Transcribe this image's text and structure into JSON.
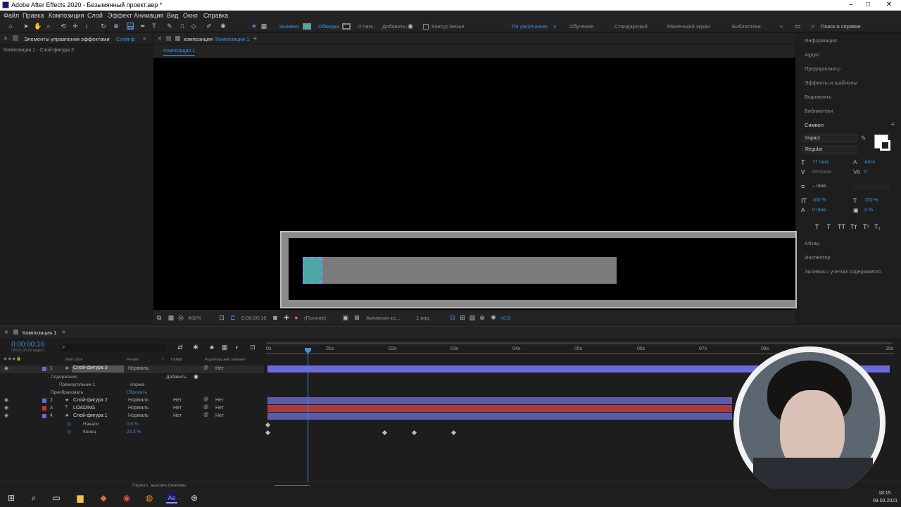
{
  "window": {
    "title": "Adobe After Effects 2020 - Безымянный проект.aep *",
    "minimize": "–",
    "maximize": "□",
    "close": "✕"
  },
  "menu": [
    "Файл",
    "Правка",
    "Композиция",
    "Слой",
    "Эффект",
    "Анимация",
    "Вид",
    "Окно",
    "Справка"
  ],
  "toolbar": {
    "fill_label": "Заливка",
    "stroke_label": "Обводка",
    "stroke_px": "0 пикс.",
    "add_label": "Добавить:",
    "bezier_label": "Контур Безье",
    "workspaces": [
      "По умолчанию",
      "Обучение",
      "Стандартный",
      "Маленький экран",
      "Библиотеки"
    ],
    "search_placeholder": "Поиск в справке"
  },
  "left_panel": {
    "tab": "Элементы управления эффектами",
    "tab_suffix": "Слой-ф",
    "subtitle": "Композиция 1 · Слой-фигура 3"
  },
  "comp_panel": {
    "tab_prefix": "композиция",
    "tab_name": "Композиция 1",
    "breadcrumb": "Композиция 1"
  },
  "viewer_bar": {
    "zoom": "400%",
    "time": "0:00:00:16",
    "resolution": "(Полное)",
    "camera": "Активная ка...",
    "views": "1 вид",
    "exposure": "+0,0"
  },
  "right_panel": {
    "items": [
      "Информация",
      "Аудио",
      "Предпросмотр",
      "Эффекты и шаблоны",
      "Выровнять",
      "Библиотеки"
    ],
    "symbol_title": "Символ",
    "font": "Impact",
    "style": "Regular",
    "size": "17 пикс.",
    "leading": "Авто",
    "kerning": "Метрики",
    "tracking": "0",
    "stroke_width": "– пикс.",
    "vscale": "100 %",
    "hscale": "100 %",
    "baseline": "0 пикс.",
    "tsume": "0 %",
    "type_buttons": [
      "T",
      "T",
      "TT",
      "Tт",
      "T¹",
      "T₁"
    ],
    "lower_items": [
      "Абзац",
      "Инспектор",
      "Заливка с учетом содержимого"
    ]
  },
  "timeline": {
    "tab": "Композиция 1",
    "current_time": "0:00:00:16",
    "fps_hint": "00016 (25.00 кадр/с)",
    "search_placeholder": "",
    "columns": {
      "name": "Имя слоя",
      "mode": "Режим",
      "t": "T",
      "trkmat": "TrkMat",
      "parent": "Родительский элемент"
    },
    "ruler": [
      "0s",
      "01s",
      "02s",
      "03s",
      "04s",
      "05s",
      "06s",
      "07s",
      "08s",
      "10s"
    ],
    "layers": [
      {
        "num": "1",
        "name": "Слой-фигура 3",
        "mode": "Нормаль",
        "trk": "",
        "parent": "Нет",
        "color": "#6a6bd8",
        "selected": true
      },
      {
        "num": "2",
        "name": "Слой-фигура 2",
        "mode": "Нормаль",
        "trk": "Нет",
        "parent": "Нет",
        "color": "#6a6bd8"
      },
      {
        "num": "3",
        "name": "LOADING",
        "mode": "Нормаль",
        "trk": "Нет",
        "parent": "Нет",
        "color": "#c23c3c"
      },
      {
        "num": "4",
        "name": "Слой-фигура 1",
        "mode": "Нормаль",
        "trk": "Нет",
        "parent": "Нет",
        "color": "#6a6bd8"
      }
    ],
    "contents_label": "Содержание",
    "add_label": "Добавить:",
    "rect_label": "Прямоугольник 1",
    "rect_mode": "Норма",
    "transform_label": "Преобразовать",
    "reset_label": "Сбросить",
    "start_label": "Начало",
    "start_value": "0,0 %",
    "end_label": "Конец",
    "end_value": "23,3 %",
    "footer": "Перекл. выключ./режимы"
  },
  "taskbar": {
    "time": "18:15",
    "date": "09.03.2021"
  },
  "colors": {
    "accent": "#3b8fe0",
    "shape": "#4aa7a2",
    "layer_blue": "#6a6bd8",
    "layer_red": "#c23c3c"
  }
}
